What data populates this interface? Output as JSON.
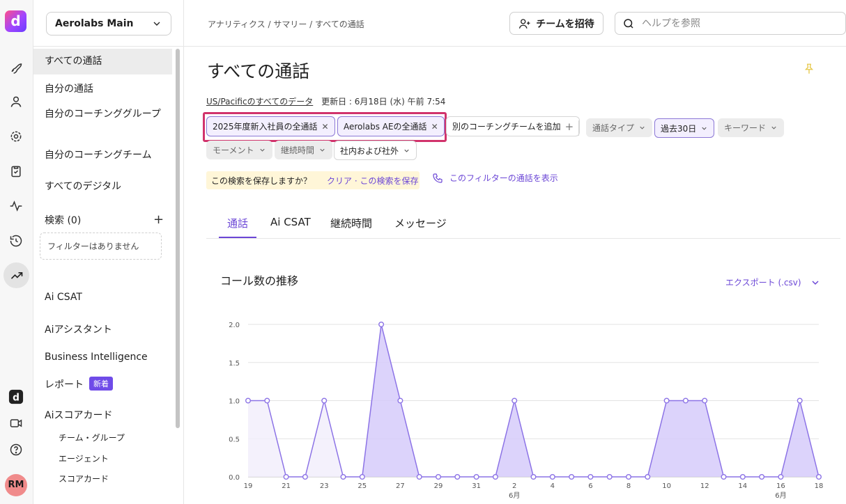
{
  "app": {
    "logo_letter": "d",
    "avatar_initials": "RM"
  },
  "rail_icons": [
    "rocket-icon",
    "person-icon",
    "gear-icon",
    "clipboard-icon",
    "activity-icon",
    "history-icon",
    "trending-icon",
    "app-logo-icon",
    "video-icon",
    "help-icon"
  ],
  "sidebar": {
    "workspace": "Aerolabs Main",
    "items": [
      {
        "label": "すべての通話"
      },
      {
        "label": "自分の通話"
      },
      {
        "label": "自分のコーチンググループ"
      },
      {
        "label": "自分のコーチングチーム"
      },
      {
        "label": "すべてのデジタル"
      }
    ],
    "search_label": "検索 (0)",
    "no_filters": "フィルターはありません",
    "lower_items": [
      {
        "label": "Ai CSAT"
      },
      {
        "label": "Aiアシスタント"
      },
      {
        "label": "Business Intelligence"
      },
      {
        "label": "レポート",
        "badge": "新着"
      },
      {
        "label": "Aiスコアカード"
      }
    ],
    "scorecard_sub": [
      "チーム・グループ",
      "エージェント",
      "スコアカード"
    ]
  },
  "topbar": {
    "breadcrumb": "アナリティクス / サマリー / すべての通話",
    "invite_label": "チームを招待",
    "help_placeholder": "ヘルプを参照"
  },
  "main": {
    "title": "すべての通話",
    "tz_link": "US/Pacificのすべてのデータ",
    "updated": "更新日 : 6月18日 (水) 午前 7:54",
    "filters": {
      "active": [
        "2025年度新入社員の全通話",
        "Aerolabs AEの全通話"
      ],
      "add_team": "別のコーチングチームを追加",
      "call_type": "通話タイプ",
      "date_range": "過去30日",
      "keyword": "キーワード",
      "moment": "モーメント",
      "duration": "継続時間",
      "scope": "社内および社外"
    },
    "save_prompt": "この検索を保存しますか？",
    "save_clear": "クリア · この検索を保存",
    "show_calls": "このフィルターの通話を表示",
    "tabs": [
      "通話",
      "Ai CSAT",
      "継続時間",
      "メッセージ"
    ],
    "active_tab": 0,
    "card_title": "コール数の推移",
    "export_label": "エクスポート (.csv)"
  },
  "colors": {
    "accent": "#6b46d6",
    "highlight": "#d1336c",
    "area_fill": "#d9cffb",
    "line": "#8c73e6"
  },
  "chart_data": {
    "type": "area",
    "title": "コール数の推移",
    "x": [
      "5/19",
      "5/20",
      "5/21",
      "5/22",
      "5/23",
      "5/24",
      "5/25",
      "5/26",
      "5/27",
      "5/28",
      "5/29",
      "5/30",
      "5/31",
      "6/1",
      "6/2",
      "6/3",
      "6/4",
      "6/5",
      "6/6",
      "6/7",
      "6/8",
      "6/9",
      "6/10",
      "6/11",
      "6/12",
      "6/13",
      "6/14",
      "6/15",
      "6/16",
      "6/17",
      "6/18"
    ],
    "tick_labels": [
      "19",
      "21",
      "23",
      "25",
      "27",
      "29",
      "31",
      "2",
      "4",
      "6",
      "8",
      "10",
      "12",
      "14",
      "16",
      "18"
    ],
    "month_labels": [
      {
        "at": "6/2",
        "label": "6月"
      },
      {
        "at": "6/16",
        "label": "6月"
      }
    ],
    "series": [
      {
        "values": [
          1,
          1,
          0,
          0,
          1,
          0,
          0,
          2,
          1,
          0,
          0,
          0,
          0,
          0,
          1,
          0,
          0,
          0,
          0,
          0,
          0,
          0,
          1,
          1,
          1,
          0,
          0,
          0,
          0,
          1,
          0
        ]
      }
    ],
    "ylim": [
      0,
      2
    ],
    "yticks": [
      "0.0",
      "0.5",
      "1.0",
      "1.5",
      "2.0"
    ],
    "grid": true
  }
}
